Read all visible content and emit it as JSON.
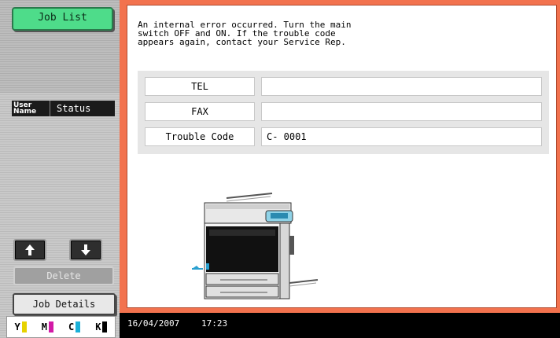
{
  "sidebar": {
    "job_list_label": "Job List",
    "user_name_label": "User\nName",
    "status_label": "Status",
    "delete_label": "Delete",
    "job_details_label": "Job Details",
    "toner": [
      {
        "letter": "Y",
        "color": "#e6d200"
      },
      {
        "letter": "M",
        "color": "#d21aa6"
      },
      {
        "letter": "C",
        "color": "#1ab0d8"
      },
      {
        "letter": "K",
        "color": "#000000"
      }
    ]
  },
  "main": {
    "message": "An internal error occurred. Turn the main\nswitch OFF and ON.  If the trouble code\nappears again, contact your Service Rep.",
    "rows": [
      {
        "label": "TEL",
        "value": ""
      },
      {
        "label": "FAX",
        "value": ""
      },
      {
        "label": "Trouble Code",
        "value": "C- 0001"
      }
    ]
  },
  "status_bar": {
    "date": "16/04/2007",
    "time": "17:23"
  },
  "colors": {
    "accent_frame": "#f2724e",
    "job_list_button": "#4edc8a"
  }
}
